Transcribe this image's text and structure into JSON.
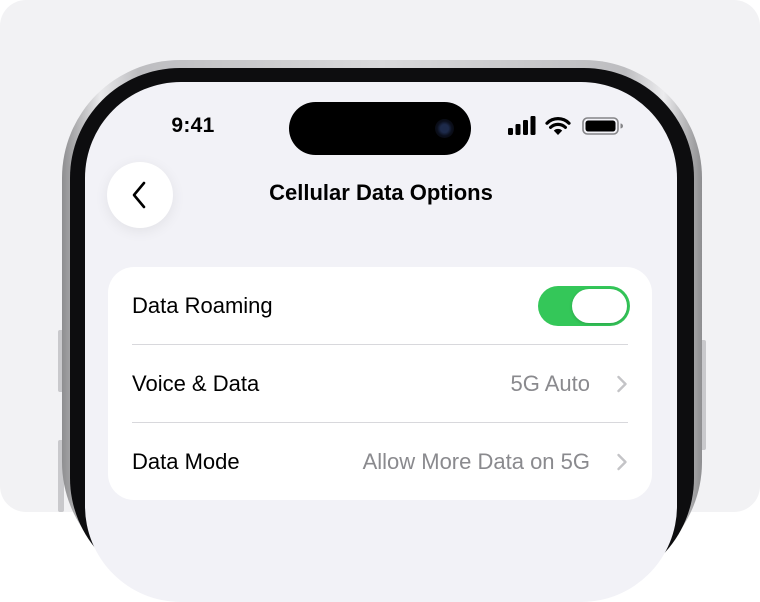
{
  "status_bar": {
    "time": "9:41"
  },
  "nav": {
    "back_icon": "chevron-left-icon",
    "title": "Cellular Data Options"
  },
  "settings": {
    "rows": [
      {
        "label": "Data Roaming",
        "control": "toggle",
        "on": true
      },
      {
        "label": "Voice & Data",
        "value": "5G Auto"
      },
      {
        "label": "Data Mode",
        "value": "Allow More Data on 5G"
      }
    ]
  },
  "colors": {
    "toggle_on": "#34c759",
    "screen_background": "#f2f2f7",
    "secondary_text": "#8a8a8e"
  }
}
